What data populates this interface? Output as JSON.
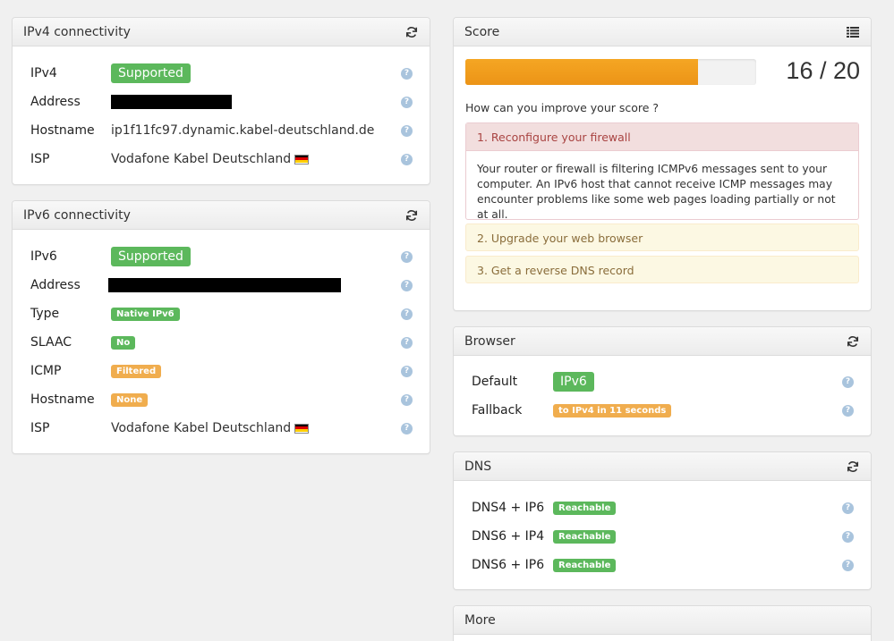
{
  "colors": {
    "green": "#5cb85c",
    "orange": "#f0ad4e",
    "bar": "#f29b22",
    "danger_bg": "#f2dede",
    "danger_text": "#a94442",
    "warn_bg": "#fcf8e3",
    "warn_text": "#8a6d3b"
  },
  "ipv4": {
    "title": "IPv4 connectivity",
    "rows": [
      {
        "label": "IPv4",
        "value": "Supported"
      },
      {
        "label": "Address",
        "value": ""
      },
      {
        "label": "Hostname",
        "value": "ip1f11fc97.dynamic.kabel-deutschland.de"
      },
      {
        "label": "ISP",
        "value": "Vodafone Kabel Deutschland"
      }
    ]
  },
  "ipv6": {
    "title": "IPv6 connectivity",
    "rows": [
      {
        "label": "IPv6",
        "value": "Supported"
      },
      {
        "label": "Address",
        "value": ""
      },
      {
        "label": "Type",
        "value": "Native IPv6"
      },
      {
        "label": "SLAAC",
        "value": "No"
      },
      {
        "label": "ICMP",
        "value": "Filtered"
      },
      {
        "label": "Hostname",
        "value": "None"
      },
      {
        "label": "ISP",
        "value": "Vodafone Kabel Deutschland"
      }
    ]
  },
  "score": {
    "title": "Score",
    "value": "16 / 20",
    "progress": 0.8,
    "improve_text": "How can you improve your score ?",
    "items": [
      {
        "title": "1. Reconfigure your firewall",
        "body": "Your router or firewall is filtering ICMPv6 messages sent to your computer. An IPv6 host that cannot receive ICMP messages may encounter problems like some web pages loading partially or not at all."
      },
      {
        "title": "2. Upgrade your web browser"
      },
      {
        "title": "3. Get a reverse DNS record"
      }
    ]
  },
  "browser": {
    "title": "Browser",
    "rows": [
      {
        "label": "Default",
        "value": "IPv6"
      },
      {
        "label": "Fallback",
        "value": "to IPv4 in 11 seconds"
      }
    ]
  },
  "dns": {
    "title": "DNS",
    "rows": [
      {
        "label": "DNS4 + IP6",
        "value": "Reachable"
      },
      {
        "label": "DNS6 + IP4",
        "value": "Reachable"
      },
      {
        "label": "DNS6 + IP6",
        "value": "Reachable"
      }
    ]
  },
  "more": {
    "title": "More"
  },
  "icons": {
    "refresh": "refresh-icon",
    "list": "list-icon",
    "help": "help-icon",
    "flag": "germany-flag-icon"
  }
}
